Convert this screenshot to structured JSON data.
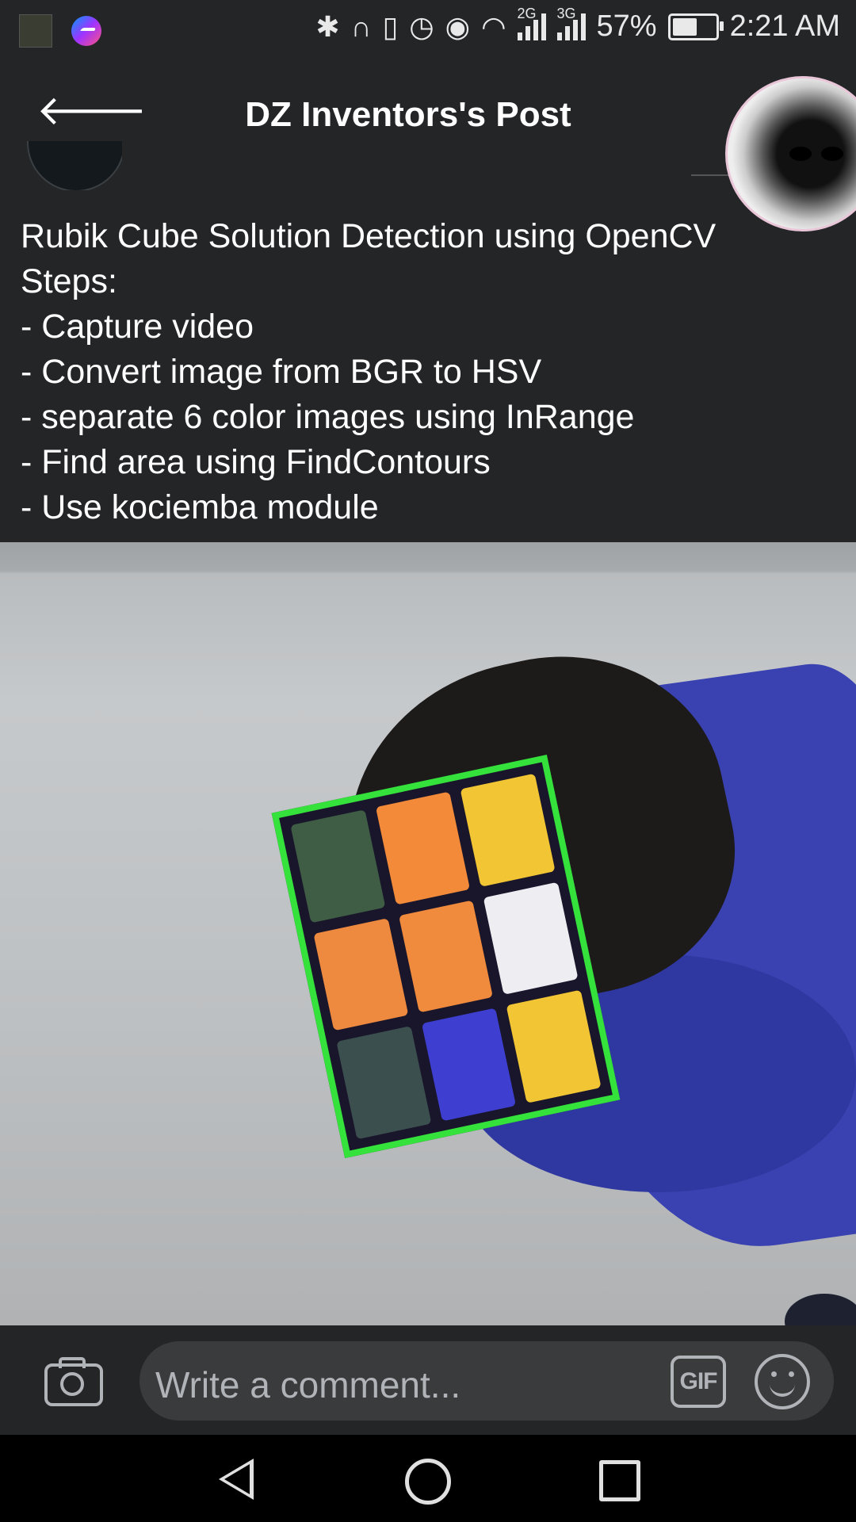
{
  "status_bar": {
    "battery_percent": "57%",
    "battery_level": 0.57,
    "time": "2:21 AM",
    "network_1": "2G",
    "network_2": "3G",
    "icons": [
      "gallery-thumbnail-icon",
      "messenger-icon",
      "bluetooth-icon",
      "headphones-icon",
      "vibrate-icon",
      "alarm-icon",
      "eye-comfort-icon",
      "wifi-icon",
      "signal-icon",
      "battery-icon"
    ]
  },
  "header": {
    "title": "DZ Inventors's Post",
    "back_icon": "arrow-left-icon"
  },
  "post": {
    "lines": [
      "Rubik Cube Solution Detection using OpenCV",
      "Steps:",
      "- Capture video",
      "- Convert image from BGR to HSV",
      "- separate 6 color images using InRange",
      "- Find area using FindContours",
      "- Use kociemba module"
    ]
  },
  "video": {
    "cube_tiles": [
      "#3f5d44",
      "#f28a3a",
      "#f1c534",
      "#ee8a3f",
      "#f08a3c",
      "#ededf2",
      "#3c4f4f",
      "#3e3fd0",
      "#f1c534"
    ],
    "accent": "#35e23c"
  },
  "comment_bar": {
    "placeholder": "Write a comment...",
    "gif_label": "GIF",
    "icons": [
      "camera-icon",
      "gif-icon",
      "emoji-icon"
    ]
  },
  "nav_bar": {
    "icons": [
      "nav-back-icon",
      "nav-home-icon",
      "nav-recents-icon"
    ]
  },
  "colors": {
    "background": "#242527",
    "text": "#ffffff",
    "secondary_text": "#b0b3b8",
    "input_bg": "#3a3b3c"
  }
}
